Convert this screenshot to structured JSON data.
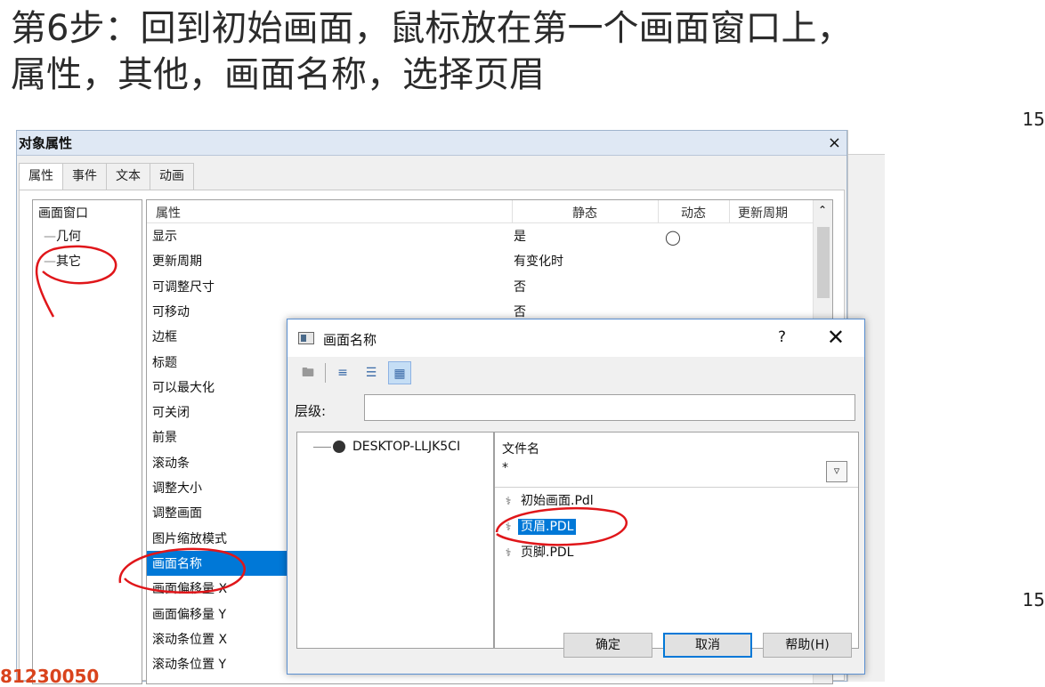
{
  "instruction": {
    "line1": "第6步：回到初始画面，鼠标放在第一个画面窗口上，",
    "line2": "属性，其他，画面名称，选择页眉"
  },
  "edge_numbers": [
    "15",
    "15"
  ],
  "watermark": "81230050",
  "properties_window": {
    "title": "对象属性",
    "close_glyph": "×",
    "tabs": [
      "属性",
      "事件",
      "文本",
      "动画"
    ],
    "tree": {
      "root": "画面窗口",
      "children": [
        "几何",
        "其它"
      ]
    },
    "grid": {
      "columns": [
        "属性",
        "静态",
        "动态",
        "更新周期"
      ],
      "rows": [
        {
          "name": "显示",
          "value": "是"
        },
        {
          "name": "更新周期",
          "value": "有变化时"
        },
        {
          "name": "可调整尺寸",
          "value": "否"
        },
        {
          "name": "可移动",
          "value": "否"
        },
        {
          "name": "边框",
          "value": ""
        },
        {
          "name": "标题",
          "value": ""
        },
        {
          "name": "可以最大化",
          "value": ""
        },
        {
          "name": "可关闭",
          "value": ""
        },
        {
          "name": "前景",
          "value": ""
        },
        {
          "name": "滚动条",
          "value": ""
        },
        {
          "name": "调整大小",
          "value": ""
        },
        {
          "name": "调整画面",
          "value": ""
        },
        {
          "name": "图片缩放模式",
          "value": ""
        },
        {
          "name": "画面名称",
          "value": ""
        },
        {
          "name": "画面偏移量 X",
          "value": ""
        },
        {
          "name": "画面偏移量 Y",
          "value": ""
        },
        {
          "name": "滚动条位置 X",
          "value": ""
        },
        {
          "name": "滚动条位置 Y",
          "value": ""
        }
      ],
      "selected_row": "画面名称"
    }
  },
  "dialog": {
    "title": "画面名称",
    "help_glyph": "?",
    "close_glyph": "✕",
    "level_label": "层级:",
    "level_value": "",
    "host": "DESKTOP-LLJK5CI",
    "file_column": "文件名",
    "filter_value": "*",
    "files": [
      {
        "name": "初始画面.Pdl",
        "selected": false
      },
      {
        "name": "页眉.PDL",
        "selected": true
      },
      {
        "name": "页脚.PDL",
        "selected": false
      }
    ],
    "buttons": {
      "ok": "确定",
      "cancel": "取消",
      "help": "帮助(H)"
    }
  },
  "annotation_color": "#e0161a"
}
